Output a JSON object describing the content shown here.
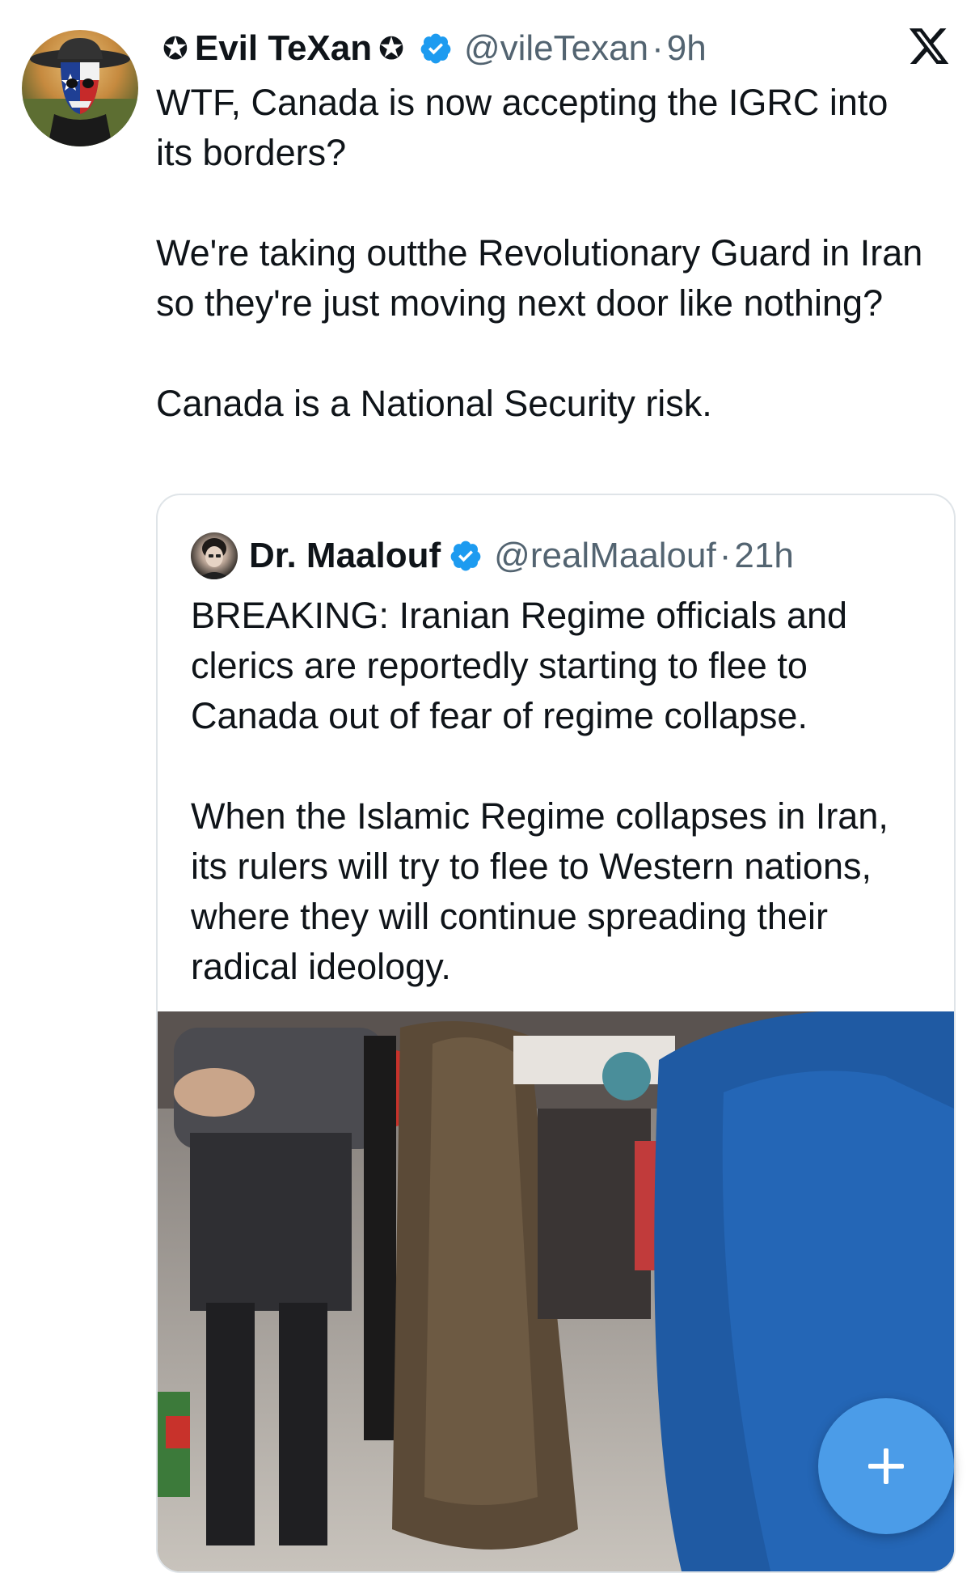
{
  "tweet": {
    "author_name": "Evil TeXan",
    "author_handle": "@vileTexan",
    "separator": "·",
    "time": "9h",
    "text": "WTF, Canada is now accepting the IGRC into its borders?\n\nWe're taking outthe Revolutionary Guard in Iran so they're just moving next door like nothing?\n\nCanada is a National Security risk.",
    "avatar_icon": "cowboy-skull-avatar",
    "verified_icon": "verified-badge-icon",
    "star_icon": "star-icon"
  },
  "quoted_tweet": {
    "author_name": "Dr. Maalouf",
    "author_handle": "@realMaalouf",
    "separator": "·",
    "time": "21h",
    "text": "BREAKING: Iranian Regime officials and clerics are reportedly starting to flee to Canada out of fear of regime collapse.\n\nWhen the Islamic Regime collapses in Iran, its rulers will try to flee to Western nations, where they will continue spreading their radical ideology.",
    "media_description_icon": "airport-video-thumbnail"
  },
  "app": {
    "logo_icon": "x-logo-icon",
    "compose_icon": "plus-icon"
  },
  "colors": {
    "verified_blue": "#1d9bf0",
    "fab_blue": "#4b9ce8",
    "text_primary": "#0f1419",
    "text_secondary": "#536471",
    "border": "#dfe4e8"
  }
}
